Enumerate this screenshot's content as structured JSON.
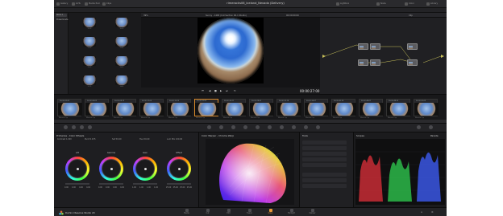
{
  "window": {
    "title": "rimerocks06_Iceland_Nevada (Delivery)"
  },
  "topbar": {
    "left_items": [
      "Gallery",
      "LUTs",
      "Media Pool",
      "Clips"
    ],
    "right_items": [
      "Lightbox",
      "Node",
      "Color",
      "Library"
    ]
  },
  "viewer": {
    "zoom": "39%",
    "clip_name": "Sunny - 1465 (Cut Section 00-1 Studio)",
    "timecode_top": "00:00:00:00",
    "timecode": "00:00:27:00"
  },
  "nodes_panel": {
    "label": "Clip"
  },
  "gallery": {
    "albums": [
      "Stills 1",
      "PowerGrade"
    ],
    "stills": [
      "1.1.1",
      "1.2.1",
      "1.3.1",
      "1.4.1",
      "1.5.1",
      "1.6.1",
      "1.7.1",
      "1.8.1"
    ]
  },
  "clips": [
    {
      "tc": "00:00:00:00",
      "label": "Monaco Clip"
    },
    {
      "tc": "00:00:04:03",
      "label": "Monaco Clip"
    },
    {
      "tc": "00:00:08:19",
      "label": "Monaco Clip"
    },
    {
      "tc": "00:00:12:00",
      "label": "Monaco Clip"
    },
    {
      "tc": "00:00:16:10",
      "label": "Monaco Clip"
    },
    {
      "tc": "00:00:20:05",
      "label": "Monaco Clip"
    },
    {
      "tc": "00:00:24:11",
      "label": "Monaco Clip"
    },
    {
      "tc": "00:00:28:02",
      "label": "Monaco Clip"
    },
    {
      "tc": "00:00:32:18",
      "label": "Monaco Clip"
    },
    {
      "tc": "00:00:36:07",
      "label": "Monaco Clip"
    },
    {
      "tc": "00:00:40:14",
      "label": "Monaco Clip"
    },
    {
      "tc": "00:00:44:01",
      "label": "Monaco Clip"
    },
    {
      "tc": "00:00:48:20",
      "label": "Monaco Clip"
    },
    {
      "tc": "00:00:52:09",
      "label": "Monaco Clip"
    }
  ],
  "selected_clip_index": 5,
  "primaries": {
    "title": "Primaries - Color Wheels",
    "wheels": [
      {
        "name": "Lift",
        "values": [
          "0.00",
          "0.00",
          "0.00",
          "0.00"
        ]
      },
      {
        "name": "Gamma",
        "values": [
          "0.00",
          "0.00",
          "0.00",
          "0.00"
        ]
      },
      {
        "name": "Gain",
        "values": [
          "1.00",
          "1.00",
          "1.00",
          "1.00"
        ]
      },
      {
        "name": "Offset",
        "values": [
          "25.00",
          "25.00",
          "25.00",
          "25.00"
        ]
      }
    ],
    "params": [
      "Contrast 1.000",
      "Pivot 0.435",
      "Sat 50.00",
      "Hue 50.00",
      "Lum Mix 100.00"
    ]
  },
  "chroma": {
    "title": "Color Warper - Chroma Warp"
  },
  "tools": {
    "title": "Tools"
  },
  "scopes": {
    "title": "Scopes",
    "mode": "Parade"
  },
  "status": {
    "brand": "DaVinci Resolve Studio 20",
    "pages": [
      "Media",
      "Cut",
      "Edit",
      "Fusion",
      "Color",
      "Fairlight",
      "Deliver"
    ],
    "active_page": "Color"
  },
  "colors": {
    "accent": "#e89a3a",
    "background": "#1c1c1e"
  }
}
